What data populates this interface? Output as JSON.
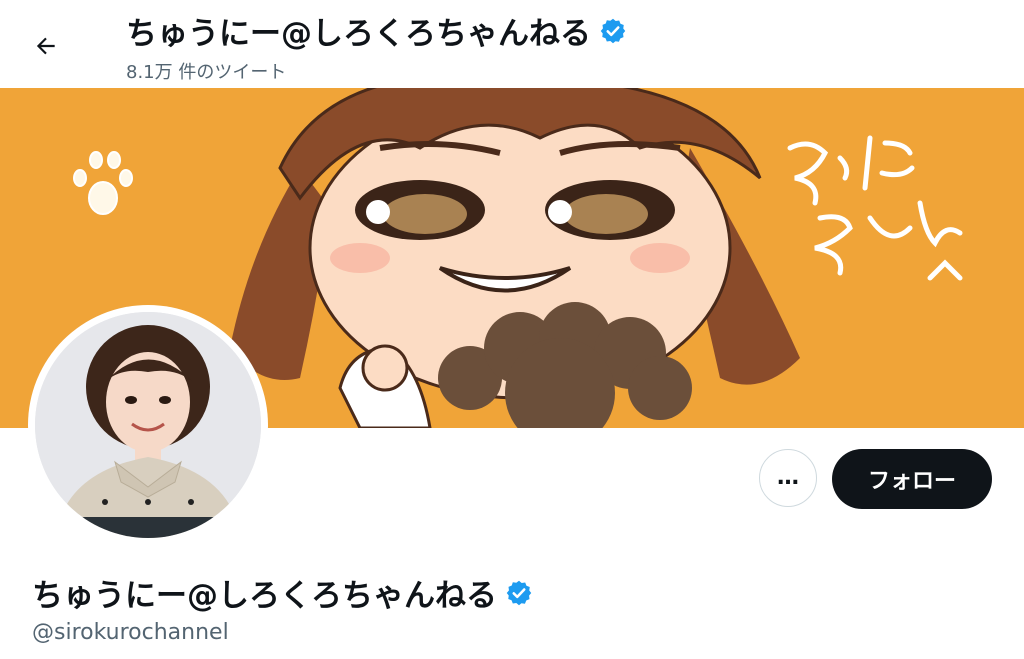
{
  "header": {
    "title": "ちゅうにー@しろくろちゃんねる",
    "tweet_count": "8.1万 件のツイート"
  },
  "profile": {
    "display_name": "ちゅうにー@しろくろちゃんねる",
    "handle": "@sirokurochannel",
    "verified": true
  },
  "actions": {
    "more_label": "…",
    "follow_label": "フォロー"
  },
  "colors": {
    "banner_orange": "#f0a438",
    "verified_blue": "#1d9bf0",
    "follow_bg": "#0f1419",
    "secondary_text": "#536471"
  }
}
